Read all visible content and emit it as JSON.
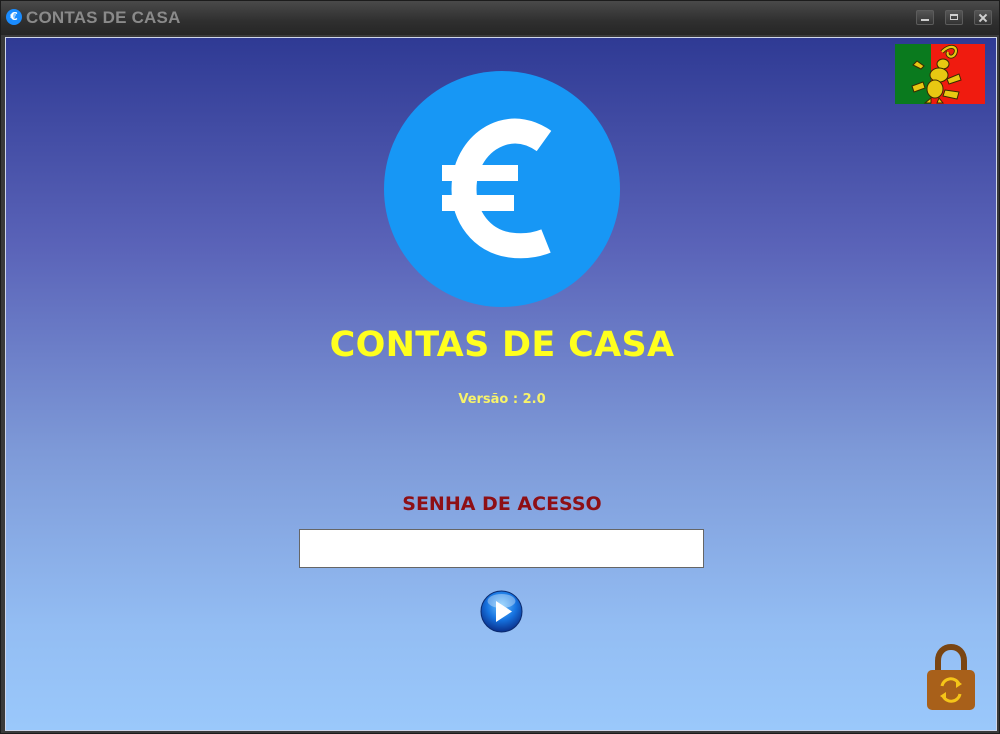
{
  "window": {
    "title": "CONTAS DE CASA",
    "app_icon_glyph": "€"
  },
  "main": {
    "app_name": "CONTAS DE CASA",
    "version": "Versão : 2.0",
    "password_label": "SENHA DE ACESSO",
    "password_value": "",
    "password_placeholder": ""
  },
  "icons": {
    "flag": "portugal-flag-scorpion-icon",
    "logo": "euro-icon",
    "go": "play-arrow-icon",
    "lock": "lock-refresh-icon"
  },
  "colors": {
    "title_yellow": "#ffff1e",
    "version_yellow": "#f7f36a",
    "label_red": "#8e0f15",
    "logo_blue": "#1797f5",
    "lock_brown": "#a8601a",
    "gradient_top": "#2f3a94",
    "gradient_bottom": "#9ac8fb"
  }
}
